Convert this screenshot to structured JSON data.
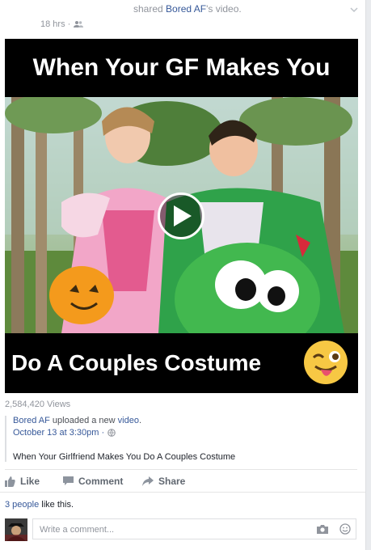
{
  "post": {
    "shared_prefix": "shared ",
    "shared_link": "Bored AF",
    "shared_suffix": "'s video.",
    "time": "18 hrs ·"
  },
  "video": {
    "caption_top": "When Your GF Makes You",
    "caption_bottom": "Do A Couples Costume",
    "views": "2,584,420 Views"
  },
  "original": {
    "author": "Bored AF",
    "mid_text": " uploaded a new ",
    "link_word": "video",
    "end": ".",
    "date": "October 13 at 3:30pm ·",
    "description": "When Your Girlfriend Makes You Do A Couples Costume"
  },
  "actions": {
    "like": "Like",
    "comment": "Comment",
    "share": "Share"
  },
  "likes": {
    "count_link": "3 people",
    "rest": " like this."
  },
  "comment": {
    "placeholder": "Write a comment..."
  },
  "icons": {
    "privacy": "friends-icon",
    "dropdown": "chevron-down-icon",
    "play": "play-icon",
    "camera": "camera-icon",
    "emoji": "smiley-icon"
  },
  "colors": {
    "link": "#365899",
    "muted": "#90949c",
    "accent": "#4267b2"
  }
}
